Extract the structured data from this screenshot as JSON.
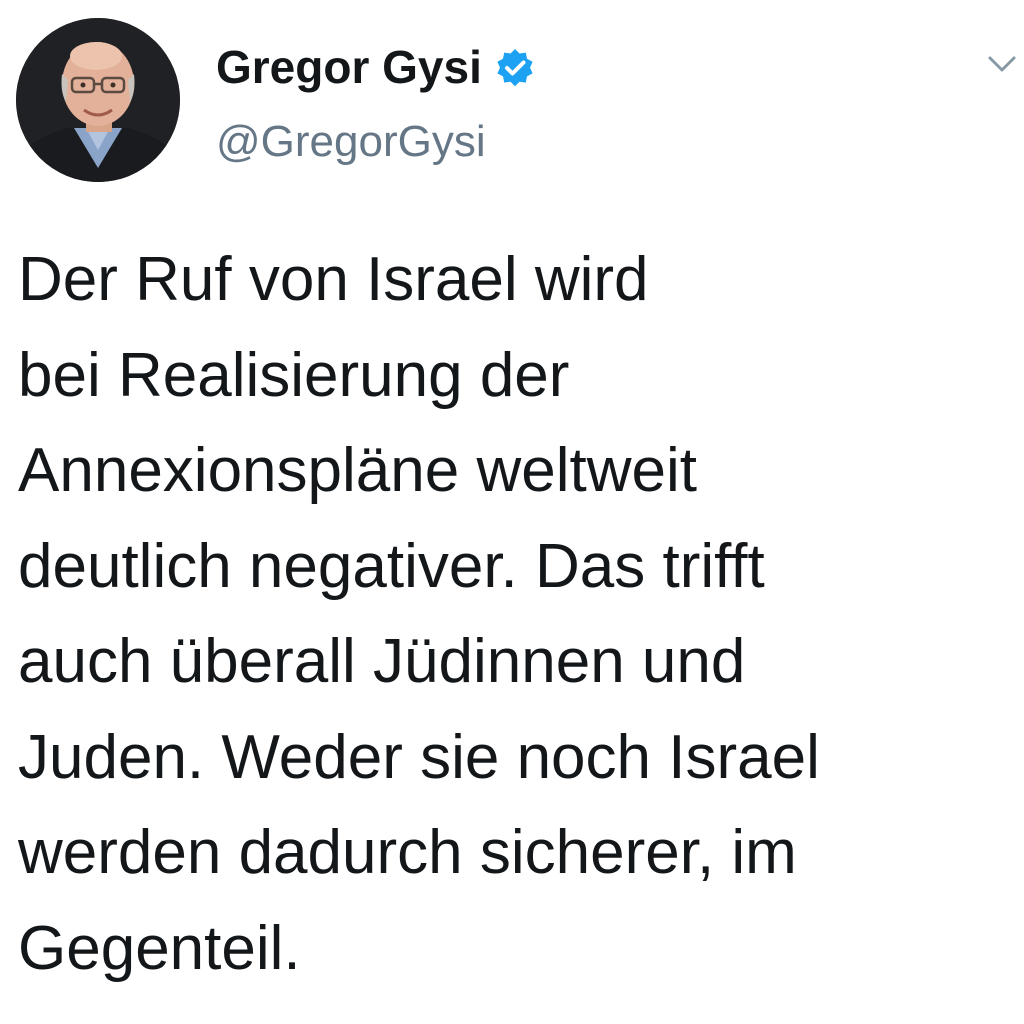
{
  "tweet": {
    "author": {
      "display_name": "Gregor Gysi",
      "handle": "@GregorGysi",
      "verified": true,
      "avatar_icon": "profile-photo",
      "verified_icon": "verified-badge-icon",
      "verified_color": "#1da1f2"
    },
    "menu_icon": "chevron-down-icon",
    "text_lines": [
      "Der Ruf von Israel wird",
      "bei Realisierung der",
      "Annexionspläne weltweit",
      "deutlich negativer. Das trifft",
      "auch überall Jüdinnen und",
      "Juden. Weder sie noch Israel",
      "werden dadurch sicherer, im",
      "Gegenteil."
    ]
  },
  "colors": {
    "background": "#ffffff",
    "text": "#14171a",
    "secondary_text": "#657786",
    "accent": "#1da1f2"
  }
}
